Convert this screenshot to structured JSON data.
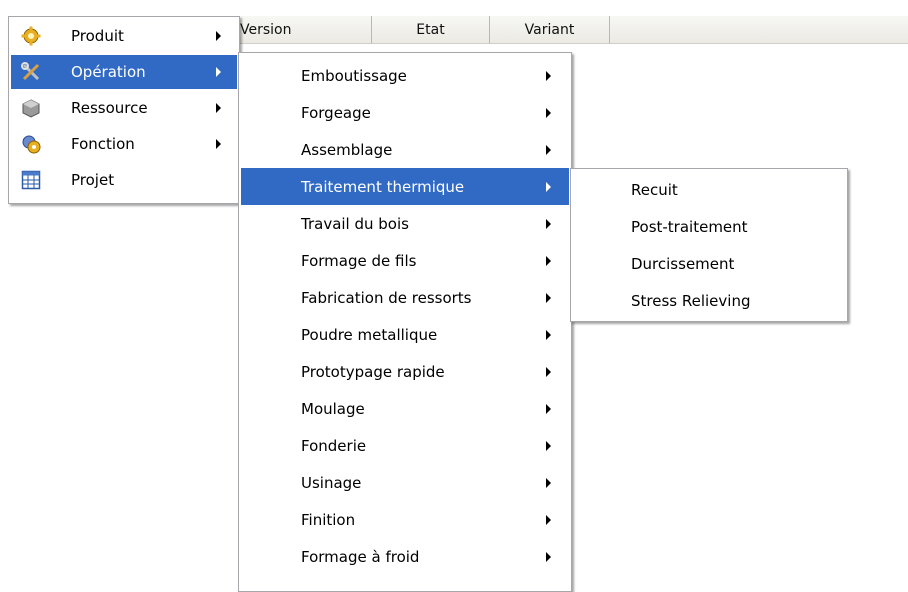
{
  "columns": {
    "version": "Version",
    "etat": "Etat",
    "variant": "Variant"
  },
  "main_menu": [
    {
      "label": "Produit",
      "icon": "gear-icon",
      "has_submenu": true
    },
    {
      "label": "Opération",
      "icon": "tools-icon",
      "has_submenu": true,
      "highlighted": true
    },
    {
      "label": "Ressource",
      "icon": "cube-icon",
      "has_submenu": true
    },
    {
      "label": "Fonction",
      "icon": "gear-function-icon",
      "has_submenu": true
    },
    {
      "label": "Projet",
      "icon": "grid-icon",
      "has_submenu": false
    }
  ],
  "operation_menu": [
    {
      "label": "Emboutissage"
    },
    {
      "label": "Forgeage"
    },
    {
      "label": "Assemblage"
    },
    {
      "label": "Traitement thermique",
      "highlighted": true
    },
    {
      "label": "Travail du bois"
    },
    {
      "label": "Formage de fils"
    },
    {
      "label": "Fabrication de ressorts"
    },
    {
      "label": "Poudre metallique"
    },
    {
      "label": "Prototypage rapide"
    },
    {
      "label": "Moulage"
    },
    {
      "label": "Fonderie"
    },
    {
      "label": "Usinage"
    },
    {
      "label": "Finition"
    },
    {
      "label": "Formage à froid"
    }
  ],
  "traitement_menu": [
    {
      "label": "Recuit"
    },
    {
      "label": "Post-traitement"
    },
    {
      "label": "Durcissement"
    },
    {
      "label": "Stress Relieving"
    }
  ],
  "colors": {
    "highlight": "#316ac5",
    "menu_border": "#a7a6aa"
  }
}
